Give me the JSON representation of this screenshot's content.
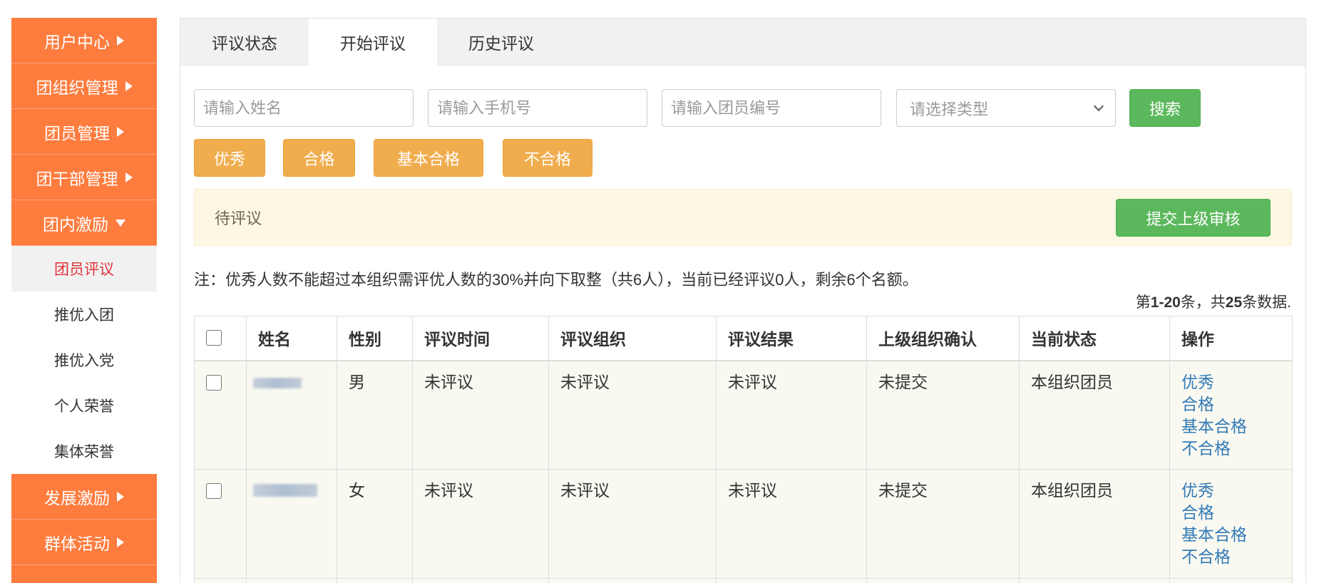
{
  "colors": {
    "sidebar_orange": "#fe7c3e",
    "active_text": "#e0313a",
    "success_green": "#5cb85c",
    "warning_amber": "#f0ad4e",
    "link_blue": "#337ab7",
    "alert_bg": "#fcf8e3"
  },
  "sidebar": {
    "items": [
      {
        "label": "用户中心",
        "icon": "caret-right-icon"
      },
      {
        "label": "团组织管理",
        "icon": "caret-right-icon"
      },
      {
        "label": "团员管理",
        "icon": "caret-right-icon"
      },
      {
        "label": "团干部管理",
        "icon": "caret-right-icon"
      },
      {
        "label": "团内激励",
        "icon": "caret-down-icon",
        "expanded": true,
        "children": [
          {
            "label": "团员评议",
            "active": true
          },
          {
            "label": "推优入团"
          },
          {
            "label": "推优入党"
          },
          {
            "label": "个人荣誉"
          },
          {
            "label": "集体荣誉"
          }
        ]
      },
      {
        "label": "发展激励",
        "icon": "caret-right-icon"
      },
      {
        "label": "群体活动",
        "icon": "caret-right-icon"
      }
    ]
  },
  "tabs": {
    "items": [
      {
        "label": "评议状态"
      },
      {
        "label": "开始评议",
        "active": true
      },
      {
        "label": "历史评议"
      }
    ]
  },
  "search": {
    "name_placeholder": "请输入姓名",
    "phone_placeholder": "请输入手机号",
    "member_no_placeholder": "请输入团员编号",
    "type_placeholder": "请选择类型",
    "search_label": "搜索"
  },
  "filters": [
    "优秀",
    "合格",
    "基本合格",
    "不合格"
  ],
  "alert": {
    "text": "待评议",
    "submit_label": "提交上级审核"
  },
  "note": "注：优秀人数不能超过本组织需评优人数的30%并向下取整（共6人），当前已经评议0人，剩余6个名额。",
  "pagination": {
    "prefix": "第",
    "range": "1-20",
    "middle": "条，共",
    "total": "25",
    "suffix": "条数据."
  },
  "table": {
    "headers": [
      "姓名",
      "性别",
      "评议时间",
      "评议组织",
      "评议结果",
      "上级组织确认",
      "当前状态",
      "操作"
    ],
    "rows": [
      {
        "gender": "男",
        "time": "未评议",
        "org": "未评议",
        "result": "未评议",
        "confirm": "未提交",
        "status": "本组织团员",
        "actions": [
          "优秀",
          "合格",
          "基本合格",
          "不合格"
        ]
      },
      {
        "gender": "女",
        "time": "未评议",
        "org": "未评议",
        "result": "未评议",
        "confirm": "未提交",
        "status": "本组织团员",
        "actions": [
          "优秀",
          "合格",
          "基本合格",
          "不合格"
        ]
      }
    ]
  }
}
